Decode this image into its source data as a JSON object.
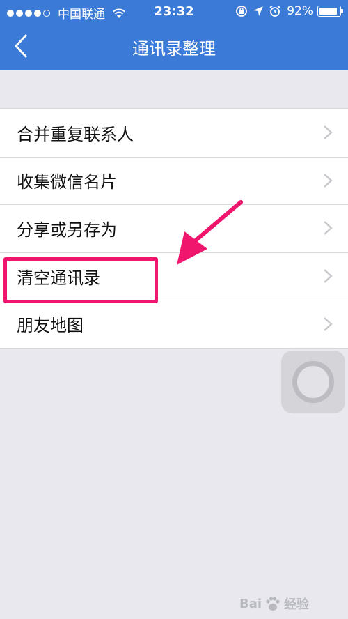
{
  "status_bar": {
    "carrier": "中国联通",
    "time": "23:32",
    "battery_percent": "92%",
    "battery_level": 0.92,
    "signal_bars": 4,
    "icons": [
      "signal-dots-icon",
      "wifi-icon",
      "rotation-lock-icon",
      "location-arrow-icon",
      "alarm-icon",
      "battery-icon"
    ]
  },
  "nav": {
    "title": "通讯录整理",
    "back_icon": "back-chevron-icon"
  },
  "menu": {
    "items": [
      {
        "label": "合并重复联系人"
      },
      {
        "label": "收集微信名片"
      },
      {
        "label": "分享或另存为"
      },
      {
        "label": "清空通讯录"
      },
      {
        "label": "朋友地图"
      }
    ],
    "chevron_icon": "chevron-right-icon"
  },
  "annotation": {
    "highlight_color": "#f0166d",
    "highlighted_item": "清空通讯录"
  },
  "watermark": {
    "text_left": "Bai",
    "text_right": "经验"
  },
  "colors": {
    "header": "#3b7ad6",
    "background": "#e8e8ee",
    "list_bg": "#ffffff",
    "chevron": "#c7c7cc"
  }
}
